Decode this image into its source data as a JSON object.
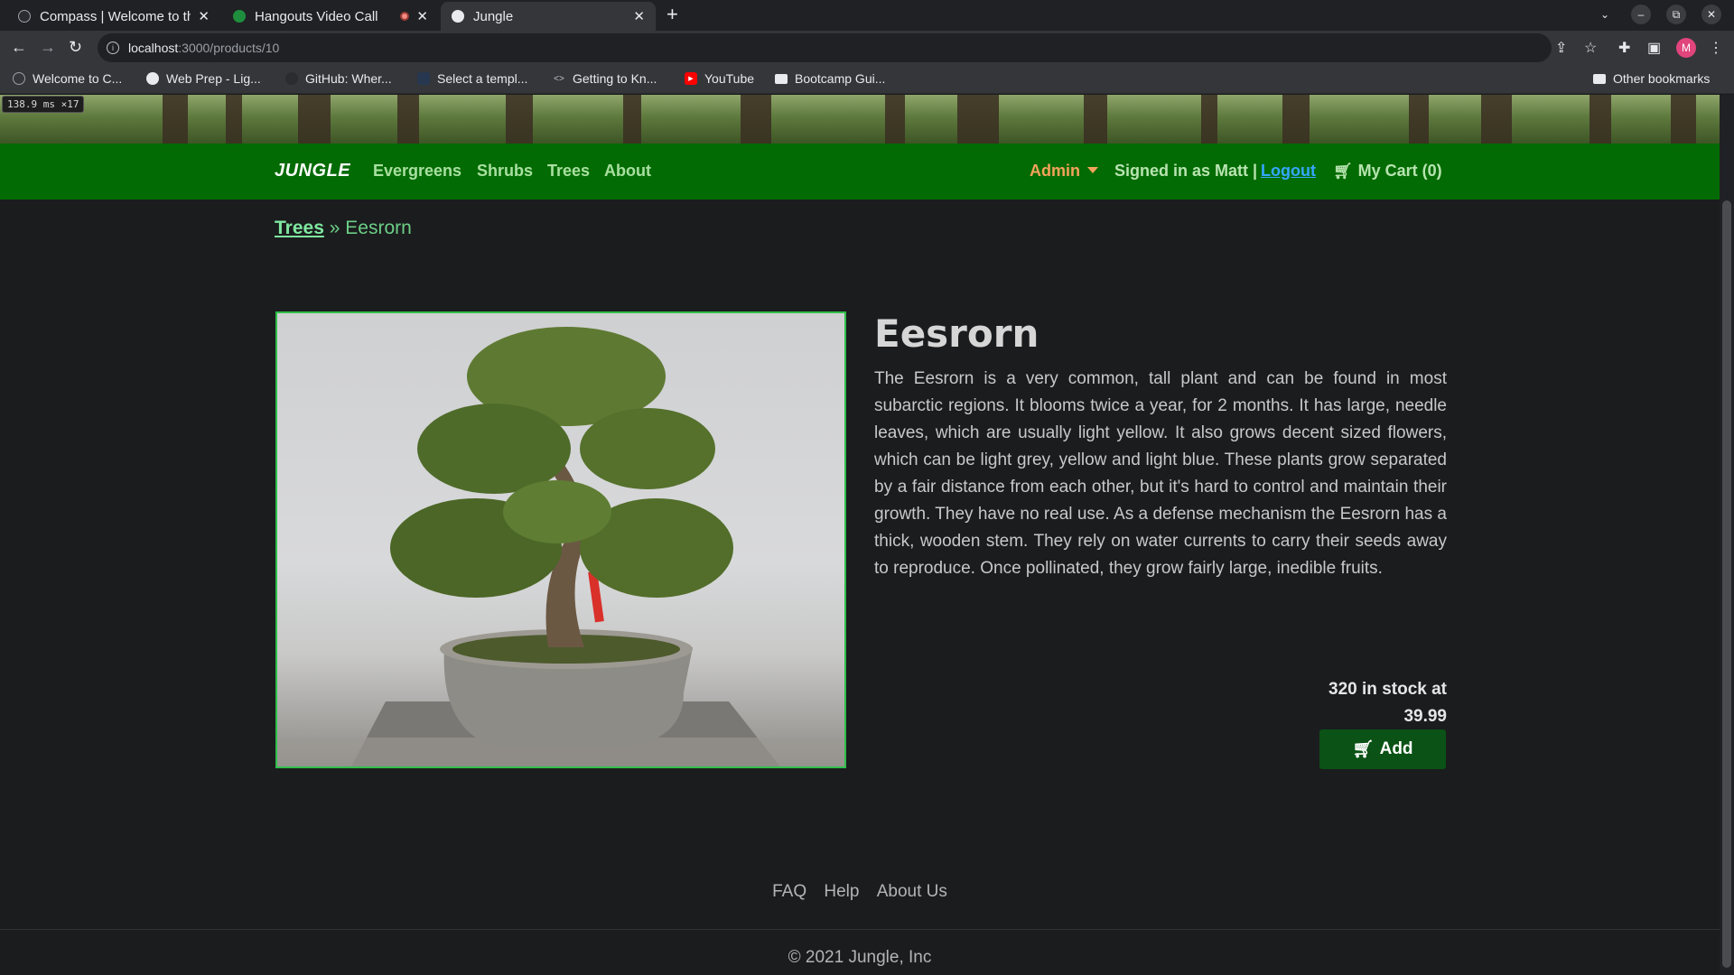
{
  "browser": {
    "tabs": [
      {
        "title": "Compass | Welcome to th",
        "close": "✕"
      },
      {
        "title": "Hangouts Video Call",
        "close": "✕"
      },
      {
        "title": "Jungle",
        "close": "✕"
      }
    ],
    "new_tab": "+",
    "window_controls": [
      "⌄",
      "–",
      "⧉",
      "✕"
    ],
    "url_host": "localhost",
    "url_path": ":3000/products/10",
    "profile_initial": "M",
    "bookmarks": [
      {
        "label": "Welcome to C...",
        "icon": "compass-icon"
      },
      {
        "label": "Web Prep - Lig...",
        "icon": "globe-icon"
      },
      {
        "label": "GitHub: Wher...",
        "icon": "github-icon"
      },
      {
        "label": "Select a templ...",
        "icon": "doc-icon"
      },
      {
        "label": "Getting to Kn...",
        "icon": "code-icon"
      },
      {
        "label": "YouTube",
        "icon": "youtube-icon"
      },
      {
        "label": "Bootcamp Gui...",
        "icon": "folder-icon"
      }
    ],
    "other_bookmarks": "Other bookmarks"
  },
  "perf_overlay": "138.9 ms ×17",
  "nav": {
    "brand": "JUNGLE",
    "links": [
      "Evergreens",
      "Shrubs",
      "Trees",
      "About"
    ],
    "admin_label": "Admin",
    "signed_in": "Signed in as Matt |",
    "logout": "Logout",
    "cart": "My Cart (0)"
  },
  "breadcrumb": {
    "parent": "Trees",
    "separator": "»",
    "current": "Eesrorn"
  },
  "product": {
    "name": "Eesrorn",
    "description": "The Eesrorn is a very common, tall plant and can be found in most subarctic regions. It blooms twice a year, for 2 months. It has large, needle leaves, which are usually light yellow. It also grows decent sized flowers, which can be light grey, yellow and light blue. These plants grow separated by a fair distance from each other, but it's hard to control and maintain their growth. They have no real use. As a defense mechanism the Eesrorn has a thick, wooden stem. They rely on water currents to carry their seeds away to reproduce. Once pollinated, they grow fairly large, inedible fruits.",
    "stock_line": "320 in stock at",
    "price": "39.99",
    "add_label": "Add"
  },
  "footer": {
    "links": [
      "FAQ",
      "Help",
      "About Us"
    ],
    "copyright": "© 2021 Jungle, Inc"
  },
  "colors": {
    "navbar": "#036b03",
    "admin": "#f5a35c",
    "logout": "#35a7ff",
    "add_button": "#0a5215",
    "image_border": "#2fbf4a"
  }
}
